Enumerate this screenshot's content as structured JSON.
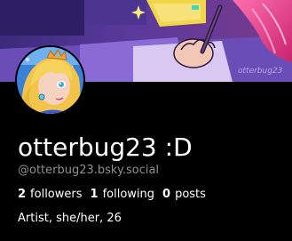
{
  "profile": {
    "display_name": "otterbug23 :D",
    "handle": "@otterbug23.bsky.social",
    "description": "Artist, she/her, 26",
    "banner_watermark": "otterbug23",
    "stats": {
      "followers_count": "2",
      "followers_label": "followers",
      "following_count": "1",
      "following_label": "following",
      "posts_count": "0",
      "posts_label": "posts"
    }
  },
  "colors": {
    "background": "#000000",
    "text_primary": "#ffffff",
    "text_secondary": "#8f8f8f"
  }
}
